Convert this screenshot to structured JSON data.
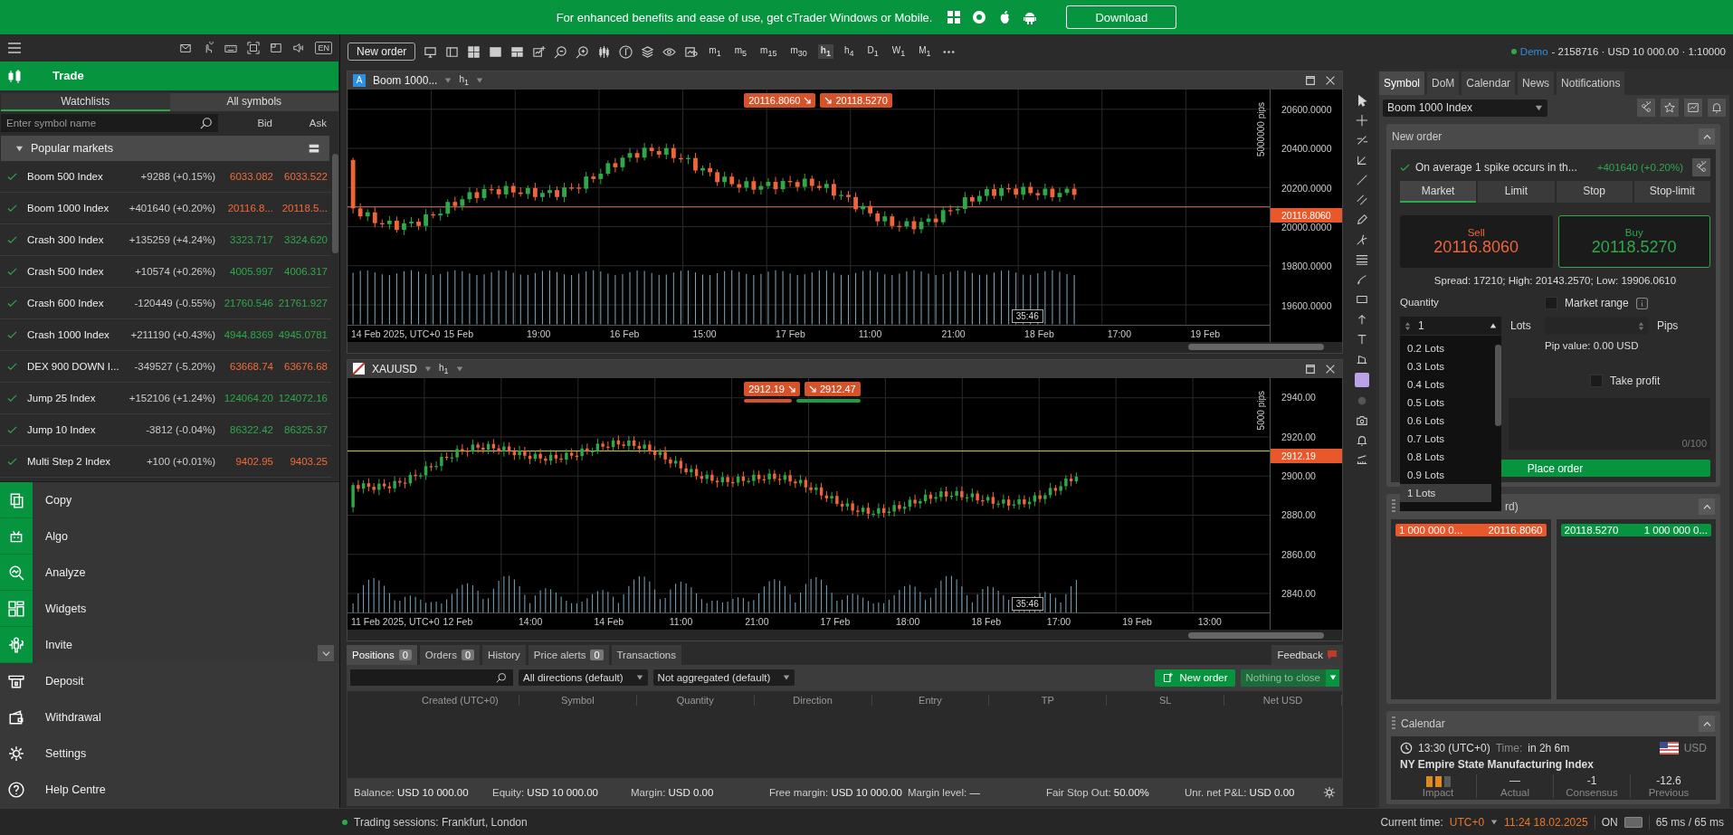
{
  "banner": {
    "text": "For enhanced benefits and ease of use, get cTrader Windows or Mobile.",
    "button": "Download"
  },
  "sidebar": {
    "language": "EN",
    "section": "Trade",
    "tabs": [
      {
        "label": "Watchlists",
        "selected": true
      },
      {
        "label": "All symbols",
        "selected": false
      }
    ],
    "search": {
      "placeholder": "Enter symbol name"
    },
    "columns": [
      "Bid",
      "Ask"
    ],
    "group": {
      "title": "Popular markets",
      "expanded": true
    },
    "symbols": [
      {
        "name": "Boom 500 Index",
        "watched": true,
        "change": "+9288 (+0.15%)",
        "bid": "6033.082",
        "ask": "6033.522",
        "color": "#f26b3a"
      },
      {
        "name": "Boom 1000 Index",
        "watched": true,
        "change": "+401640 (+0.20%)",
        "bid": "20116.8...",
        "ask": "20118.5...",
        "color": "#f26b3a"
      },
      {
        "name": "Crash 300 Index",
        "watched": true,
        "change": "+135259 (+4.24%)",
        "bid": "3323.717",
        "ask": "3324.620",
        "color": "#2fa84a"
      },
      {
        "name": "Crash 500 Index",
        "watched": true,
        "change": "+10574 (+0.26%)",
        "bid": "4005.997",
        "ask": "4006.317",
        "color": "#2fa84a"
      },
      {
        "name": "Crash 600 Index",
        "watched": true,
        "change": "-120449 (-0.55%)",
        "bid": "21760.546",
        "ask": "21761.927",
        "color": "#2fa84a"
      },
      {
        "name": "Crash 1000 Index",
        "watched": true,
        "change": "+211190 (+0.43%)",
        "bid": "4944.8369",
        "ask": "4945.0781",
        "color": "#2fa84a"
      },
      {
        "name": "DEX 900 DOWN I...",
        "watched": true,
        "change": "-349527 (-5.20%)",
        "bid": "63668.74",
        "ask": "63676.68",
        "color": "#f26b3a"
      },
      {
        "name": "Jump 25 Index",
        "watched": true,
        "change": "+152106 (+1.24%)",
        "bid": "124064.20",
        "ask": "124072.16",
        "color": "#2fa84a"
      },
      {
        "name": "Jump 10 Index",
        "watched": true,
        "change": "-3812 (-0.04%)",
        "bid": "86322.42",
        "ask": "86325.37",
        "color": "#2fa84a"
      },
      {
        "name": "Multi Step 2 Index",
        "watched": true,
        "change": "+100 (+0.01%)",
        "bid": "9402.95",
        "ask": "9403.25",
        "color": "#f26b3a"
      }
    ],
    "nav": [
      {
        "label": "Copy",
        "kind": "primary"
      },
      {
        "label": "Algo",
        "kind": "primary"
      },
      {
        "label": "Analyze",
        "kind": "primary"
      },
      {
        "label": "Widgets",
        "kind": "primary"
      },
      {
        "label": "Invite",
        "kind": "primary"
      },
      {
        "label": "Deposit",
        "kind": "secondary"
      },
      {
        "label": "Withdrawal",
        "kind": "secondary"
      },
      {
        "label": "Settings",
        "kind": "secondary"
      },
      {
        "label": "Help Centre",
        "kind": "secondary"
      }
    ]
  },
  "toolbar": {
    "new_order": "New order",
    "timeframes": [
      {
        "unit": "m",
        "count": "1",
        "selected": false
      },
      {
        "unit": "m",
        "count": "5",
        "selected": false
      },
      {
        "unit": "m",
        "count": "15",
        "selected": false
      },
      {
        "unit": "m",
        "count": "30",
        "selected": false
      },
      {
        "unit": "h",
        "count": "1",
        "selected": true
      },
      {
        "unit": "h",
        "count": "4",
        "selected": false
      },
      {
        "unit": "D",
        "count": "1",
        "selected": false
      },
      {
        "unit": "W",
        "count": "1",
        "selected": false
      },
      {
        "unit": "M",
        "count": "1",
        "selected": false
      }
    ],
    "account": {
      "mode": "Demo",
      "details": "- 2158716 · USD 10 000.00 · 1:10000"
    }
  },
  "charts": [
    {
      "badge": "A",
      "symbol": "Boom 1000...",
      "timeframe": {
        "unit": "h",
        "count": "1"
      },
      "sell": "20116.8060",
      "buy": "20118.5270",
      "spread_bar": false,
      "range": "5000000 pips",
      "price": "20116.8060",
      "countdown": "35:46",
      "y_labels": [
        "20600.0000",
        "20400.0000",
        "20200.0000",
        "20000.0000",
        "19800.0000",
        "19600.0000"
      ],
      "x_labels": [
        "14 Feb 2025, UTC+0",
        "15 Feb",
        "19:00",
        "16 Feb",
        "15:00",
        "17 Feb",
        "11:00",
        "21:00",
        "18 Feb",
        "17:00",
        "19 Feb"
      ]
    },
    {
      "symbol": "XAUUSD",
      "timeframe": {
        "unit": "h",
        "count": "1"
      },
      "sell": "2912.19",
      "buy": "2912.47",
      "spread_bar": true,
      "range": "5000 pips",
      "price": "2912.19",
      "countdown": "35:46",
      "y_labels": [
        "2940.00",
        "2920.00",
        "2900.00",
        "2880.00",
        "2860.00",
        "2840.00"
      ],
      "x_labels": [
        "11 Feb 2025, UTC+0",
        "12 Feb",
        "14:00",
        "14 Feb",
        "11:00",
        "21:00",
        "17 Feb",
        "18:00",
        "18 Feb",
        "17:00",
        "19 Feb",
        "13:00"
      ]
    }
  ],
  "positions": {
    "tabs": [
      {
        "label": "Positions",
        "count": "0",
        "selected": true
      },
      {
        "label": "Orders",
        "count": "0",
        "selected": false
      },
      {
        "label": "History",
        "selected": false
      },
      {
        "label": "Price alerts",
        "count": "0",
        "selected": false
      },
      {
        "label": "Transactions",
        "selected": false
      }
    ],
    "feedback": "Feedback",
    "filters": [
      "All directions (default)",
      "Not aggregated (default)"
    ],
    "new_order": "New order",
    "close_all": {
      "label": "Nothing to close",
      "disabled": true
    },
    "columns": [
      "Created (UTC+0)",
      "Symbol",
      "Quantity",
      "Direction",
      "Entry",
      "TP",
      "SL",
      "Net USD"
    ],
    "summary": [
      {
        "label": "Balance:",
        "value": "USD 10 000.00"
      },
      {
        "label": "Equity:",
        "value": "USD 10 000.00"
      },
      {
        "label": "Margin:",
        "value": "USD 0.00"
      },
      {
        "label": "Free margin:",
        "value": "USD 10 000.00"
      },
      {
        "label": "Margin level:",
        "value": "—"
      },
      {
        "label": "Fair Stop Out:",
        "value": "50.00%"
      },
      {
        "label": "Unr. net P&L:",
        "value": "USD 0.00"
      }
    ]
  },
  "symbol_panel": {
    "tabs": [
      {
        "label": "Symbol",
        "selected": true
      },
      {
        "label": "DoM",
        "selected": false
      },
      {
        "label": "Calendar",
        "selected": false
      },
      {
        "label": "News",
        "selected": false
      },
      {
        "label": "Notifications",
        "selected": false
      }
    ],
    "symbol": "Boom 1000 Index",
    "new_order": {
      "title": "New order",
      "info": "On average 1 spike occurs in th...",
      "change": "+401640 (+0.20%)",
      "order_types": [
        {
          "label": "Market",
          "selected": true
        },
        {
          "label": "Limit",
          "selected": false
        },
        {
          "label": "Stop",
          "selected": false
        },
        {
          "label": "Stop-limit",
          "selected": false
        }
      ],
      "sell": {
        "label": "Sell",
        "price": "20116.8060",
        "selected": false
      },
      "buy": {
        "label": "Buy",
        "price": "20118.5270",
        "selected": true
      },
      "stats": "Spread: 17210; High: 20143.2570; Low: 19906.0610",
      "quantity": {
        "label": "Quantity",
        "value": "1",
        "unit": "Lots"
      },
      "market_range": {
        "label": "Market range",
        "checked": false
      },
      "pips_unit": "Pips",
      "pip_value": "Pip value: 0.00 USD",
      "take_profit": {
        "label": "Take profit",
        "checked": false
      },
      "comment_counter": "0/100",
      "submit": "Place order",
      "lot_options": [
        {
          "label": "0.2 Lots",
          "selected": false
        },
        {
          "label": "0.3 Lots",
          "selected": false
        },
        {
          "label": "0.4 Lots",
          "selected": false
        },
        {
          "label": "0.5 Lots",
          "selected": false
        },
        {
          "label": "0.6 Lots",
          "selected": false
        },
        {
          "label": "0.7 Lots",
          "selected": false
        },
        {
          "label": "0.8 Lots",
          "selected": false
        },
        {
          "label": "0.9 Lots",
          "selected": false
        },
        {
          "label": "1 Lots",
          "selected": true
        }
      ]
    },
    "depth": {
      "title": "rd)",
      "sell": {
        "volume": "1 000 000 0...",
        "price": "20116.8060"
      },
      "buy": {
        "price": "20118.5270",
        "volume": "1 000 000 0..."
      }
    },
    "calendar": {
      "title": "Calendar",
      "time": "13:30 (UTC+0)",
      "time_label": "Time:",
      "countdown": "in 2h 6m",
      "currency": "USD",
      "event": "NY Empire State Manufacturing Index",
      "stats": [
        {
          "kind": "impact",
          "label": "Impact",
          "stars": 2
        },
        {
          "kind": "value",
          "value": "—",
          "label": "Actual"
        },
        {
          "kind": "value",
          "value": "-1",
          "label": "Consensus"
        },
        {
          "kind": "value",
          "value": "-12.6",
          "label": "Previous"
        }
      ]
    }
  },
  "status_bar": {
    "sessions": "Trading sessions: Frankfurt, London",
    "time_label": "Current time:",
    "timezone": "UTC+0",
    "time": "11:24 18.02.2025",
    "toggle": {
      "label": "ON",
      "on": true
    },
    "latency": "65 ms / 65 ms"
  }
}
